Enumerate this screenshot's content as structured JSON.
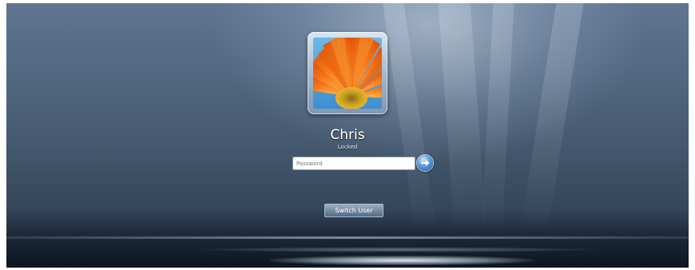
{
  "account": {
    "user_name": "Chris",
    "status": "Locked"
  },
  "login": {
    "password_placeholder": "Password",
    "password_value": ""
  },
  "actions": {
    "switch_user_label": "Switch User"
  },
  "icons": {
    "submit": "arrow-right-icon",
    "account_picture": "orange-daisy-photo"
  },
  "colors": {
    "sky_top": "#5f7591",
    "sea": "#0c1520",
    "submit_blue": "#2a6fb8",
    "flower_orange": "#f26a0d"
  }
}
